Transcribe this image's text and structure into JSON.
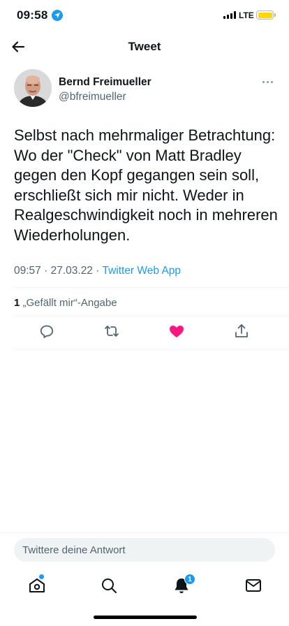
{
  "status_bar": {
    "time": "09:58",
    "network": "LTE",
    "colors": {
      "battery": "#ffd60a",
      "location": "#1d9bf0"
    }
  },
  "header": {
    "title": "Tweet",
    "back_icon": "arrow-left-icon"
  },
  "tweet": {
    "author_name": "Bernd Freimueller",
    "author_handle": "@bfreimueller",
    "text": "Selbst nach mehrmaliger Betrachtung: Wo der \"Check\" von Matt Bradley gegen den Kopf gegangen sein soll, erschließt sich mir nicht. Weder in Realgeschwindigkeit noch in mehreren Wiederholungen.",
    "time": "09:57",
    "date": "27.03.22",
    "separator": "·",
    "app": "Twitter Web App",
    "like_count": "1",
    "like_label": "„Gefällt mir“-Angabe"
  },
  "actions": {
    "icons": [
      "reply-icon",
      "retweet-icon",
      "like-icon",
      "share-icon"
    ],
    "like_color": "#f91880"
  },
  "reply": {
    "placeholder": "Twittere deine Antwort"
  },
  "tab_bar": {
    "icons": [
      "home-icon",
      "search-icon",
      "notifications-icon",
      "messages-icon"
    ],
    "notification_count": "1",
    "accent": "#1d9bf0"
  }
}
